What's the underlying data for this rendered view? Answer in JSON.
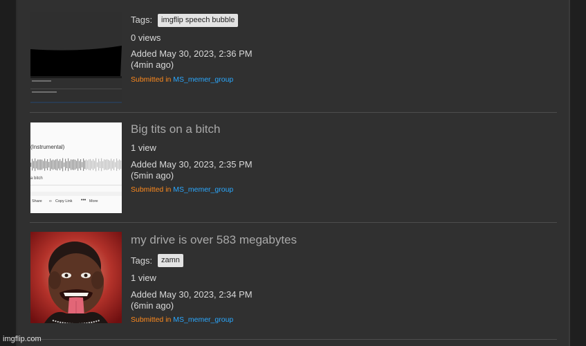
{
  "watermark": "imgflip.com",
  "items": [
    {
      "tags_label": "Tags:",
      "tags": [
        "imgflip speech bubble"
      ],
      "views": "0 views",
      "added": "Added May 30, 2023, 2:36 PM",
      "ago": "(4min ago)",
      "submitted_prefix": "Submitted in",
      "group": "MS_memer_group"
    },
    {
      "title": "Big tits on a bitch",
      "thumb_text": {
        "instrumental": "(Instrumental)",
        "bitch": "a bitch",
        "share": "Share",
        "copy_link": "Copy Link",
        "more": "More"
      },
      "views": "1 view",
      "added": "Added May 30, 2023, 2:35 PM",
      "ago": "(5min ago)",
      "submitted_prefix": "Submitted in",
      "group": "MS_memer_group"
    },
    {
      "title": "my drive is over 583 megabytes",
      "tags_label": "Tags:",
      "tags": [
        "zamn"
      ],
      "views": "1 view",
      "added": "Added May 30, 2023, 2:34 PM",
      "ago": "(6min ago)",
      "submitted_prefix": "Submitted in",
      "group": "MS_memer_group"
    }
  ]
}
